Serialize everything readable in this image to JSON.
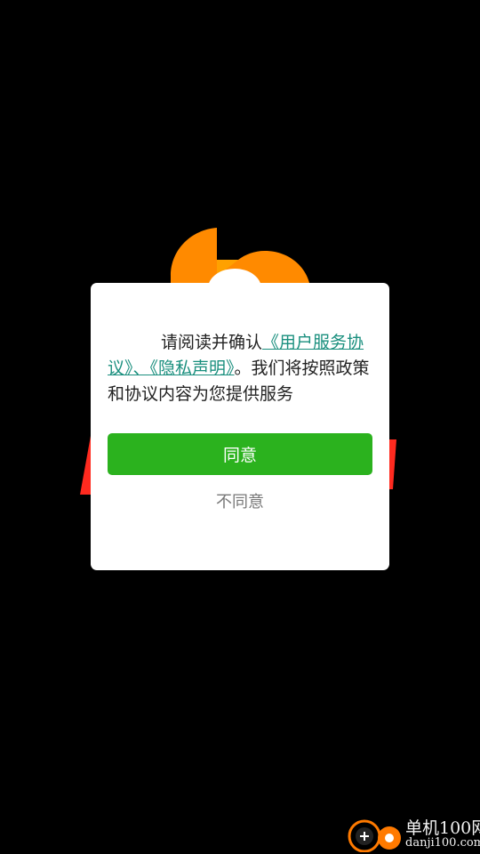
{
  "dialog": {
    "message_prefix": "请阅读并确认",
    "user_agreement_link": "《用户服务协议》",
    "separator": "、",
    "privacy_link": "《隐私声明》",
    "message_suffix": "。我们将按照政策和协议内容为您提供服务",
    "agree_label": "同意",
    "disagree_label": "不同意"
  },
  "watermark": {
    "title": "单机100网",
    "url": "danji100.com"
  },
  "colors": {
    "background": "#000000",
    "dialog_background": "#ffffff",
    "agree_button": "#2bb21e",
    "link": "#1a8f7e",
    "logo_orange": "#ff8a00",
    "banner_red": "#ff2a1f"
  },
  "icons": {
    "splash_logo": "orange-app-logo-icon",
    "watermark_logo": "danji100-logo-icon"
  }
}
